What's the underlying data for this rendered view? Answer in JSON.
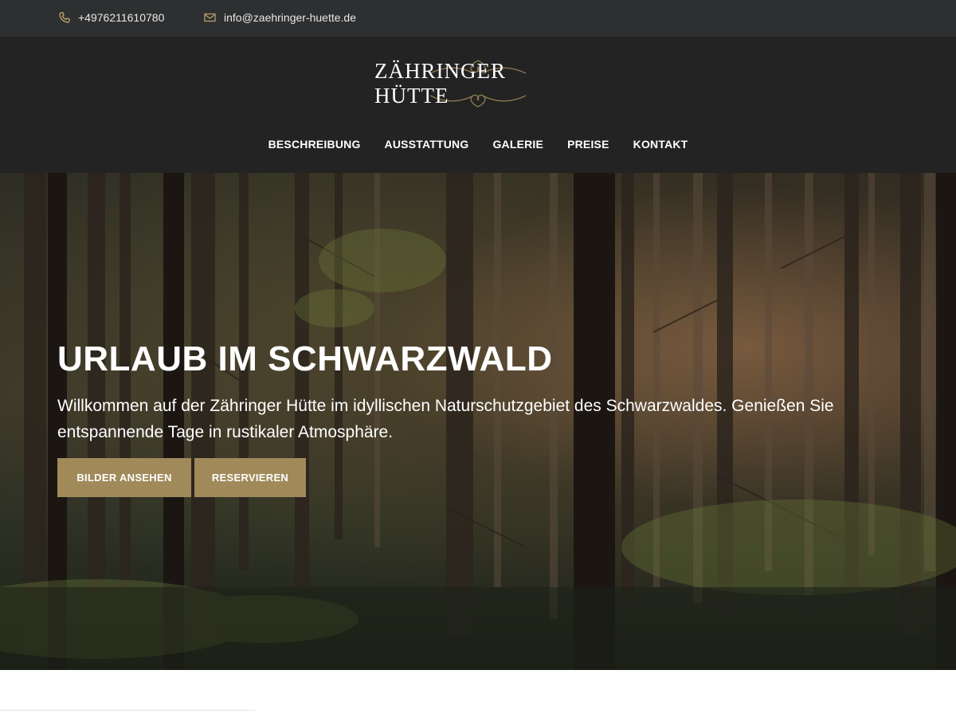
{
  "topbar": {
    "phone": "+4976211610780",
    "phone_icon": "phone-icon",
    "email": "info@zaehringer-huette.de",
    "email_icon": "mail-icon"
  },
  "header": {
    "brand": "ZÄHRINGER HÜTTE",
    "nav": [
      "BESCHREIBUNG",
      "AUSSTATTUNG",
      "GALERIE",
      "PREISE",
      "KONTAKT"
    ]
  },
  "hero": {
    "title": "URLAUB IM SCHWARZWALD",
    "text": "Willkommen auf der Zähringer Hütte im idyllischen Naturschutzgebiet des Schwarzwaldes. Genießen Sie entspannende Tage in rustikaler Atmosphäre.",
    "buttons": [
      "BILDER ANSEHEN",
      "RESERVIEREN"
    ]
  },
  "colors": {
    "topbar_bg": "#2e2f30",
    "header_bg": "#222322",
    "accent": "#a08a5a"
  }
}
